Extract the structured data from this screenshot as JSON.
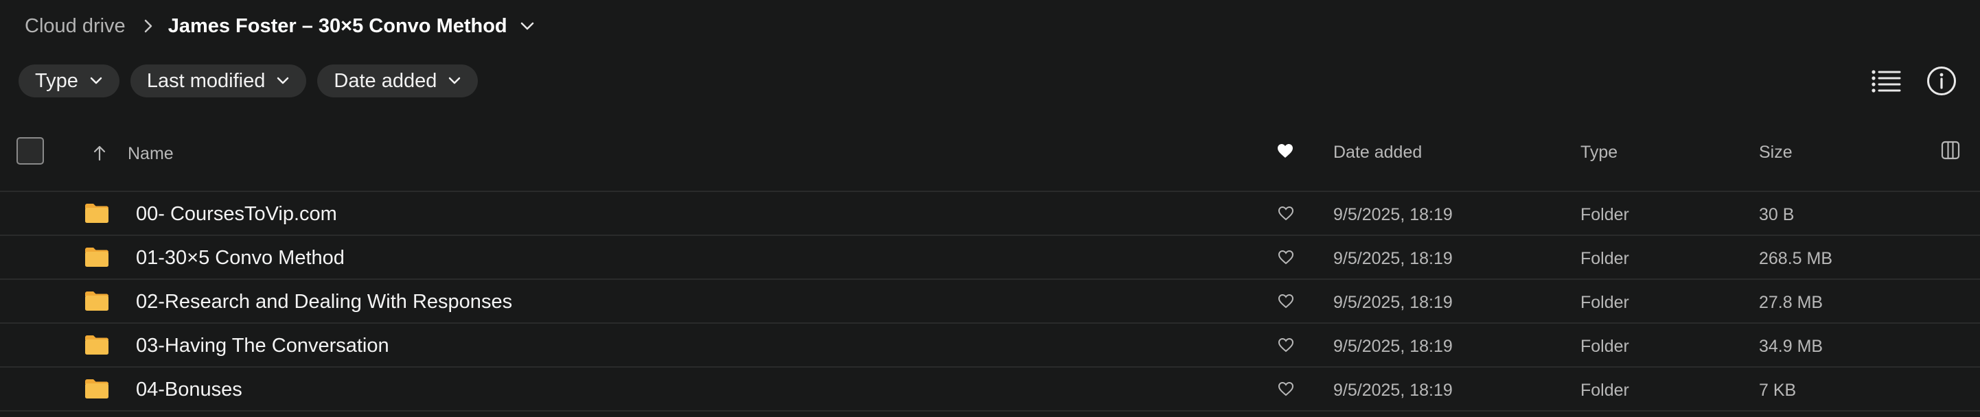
{
  "breadcrumb": {
    "root": "Cloud drive",
    "current": "James Foster – 30×5 Convo Method",
    "separator_icon": "chevron-right-icon",
    "caret_icon": "chevron-down-icon"
  },
  "filters": [
    {
      "label": "Type",
      "icon": "chevron-down-icon"
    },
    {
      "label": "Last modified",
      "icon": "chevron-down-icon"
    },
    {
      "label": "Date added",
      "icon": "chevron-down-icon"
    }
  ],
  "toolbar": {
    "view_icon": "list-view-icon",
    "info_icon": "info-icon"
  },
  "table": {
    "columns": {
      "name": "Name",
      "date_added": "Date added",
      "type": "Type",
      "size": "Size"
    },
    "sort_icon": "arrow-up-icon",
    "favorite_header_icon": "heart-filled-icon",
    "column_settings_icon": "columns-icon",
    "rows": [
      {
        "name": "00- CoursesToVip.com",
        "date_added": "9/5/2025, 18:19",
        "type": "Folder",
        "size": "30 B",
        "icon": "folder-icon"
      },
      {
        "name": "01-30×5 Convo Method",
        "date_added": "9/5/2025, 18:19",
        "type": "Folder",
        "size": "268.5 MB",
        "icon": "folder-icon"
      },
      {
        "name": "02-Research and Dealing With Responses",
        "date_added": "9/5/2025, 18:19",
        "type": "Folder",
        "size": "27.8 MB",
        "icon": "folder-icon"
      },
      {
        "name": "03-Having The Conversation",
        "date_added": "9/5/2025, 18:19",
        "type": "Folder",
        "size": "34.9 MB",
        "icon": "folder-icon"
      },
      {
        "name": "04-Bonuses",
        "date_added": "9/5/2025, 18:19",
        "type": "Folder",
        "size": "7 KB",
        "icon": "folder-icon"
      }
    ]
  },
  "colors": {
    "background": "#181919",
    "chip_background": "#2f3030",
    "folder": "#f5b944",
    "divider": "#2a2b2b"
  }
}
